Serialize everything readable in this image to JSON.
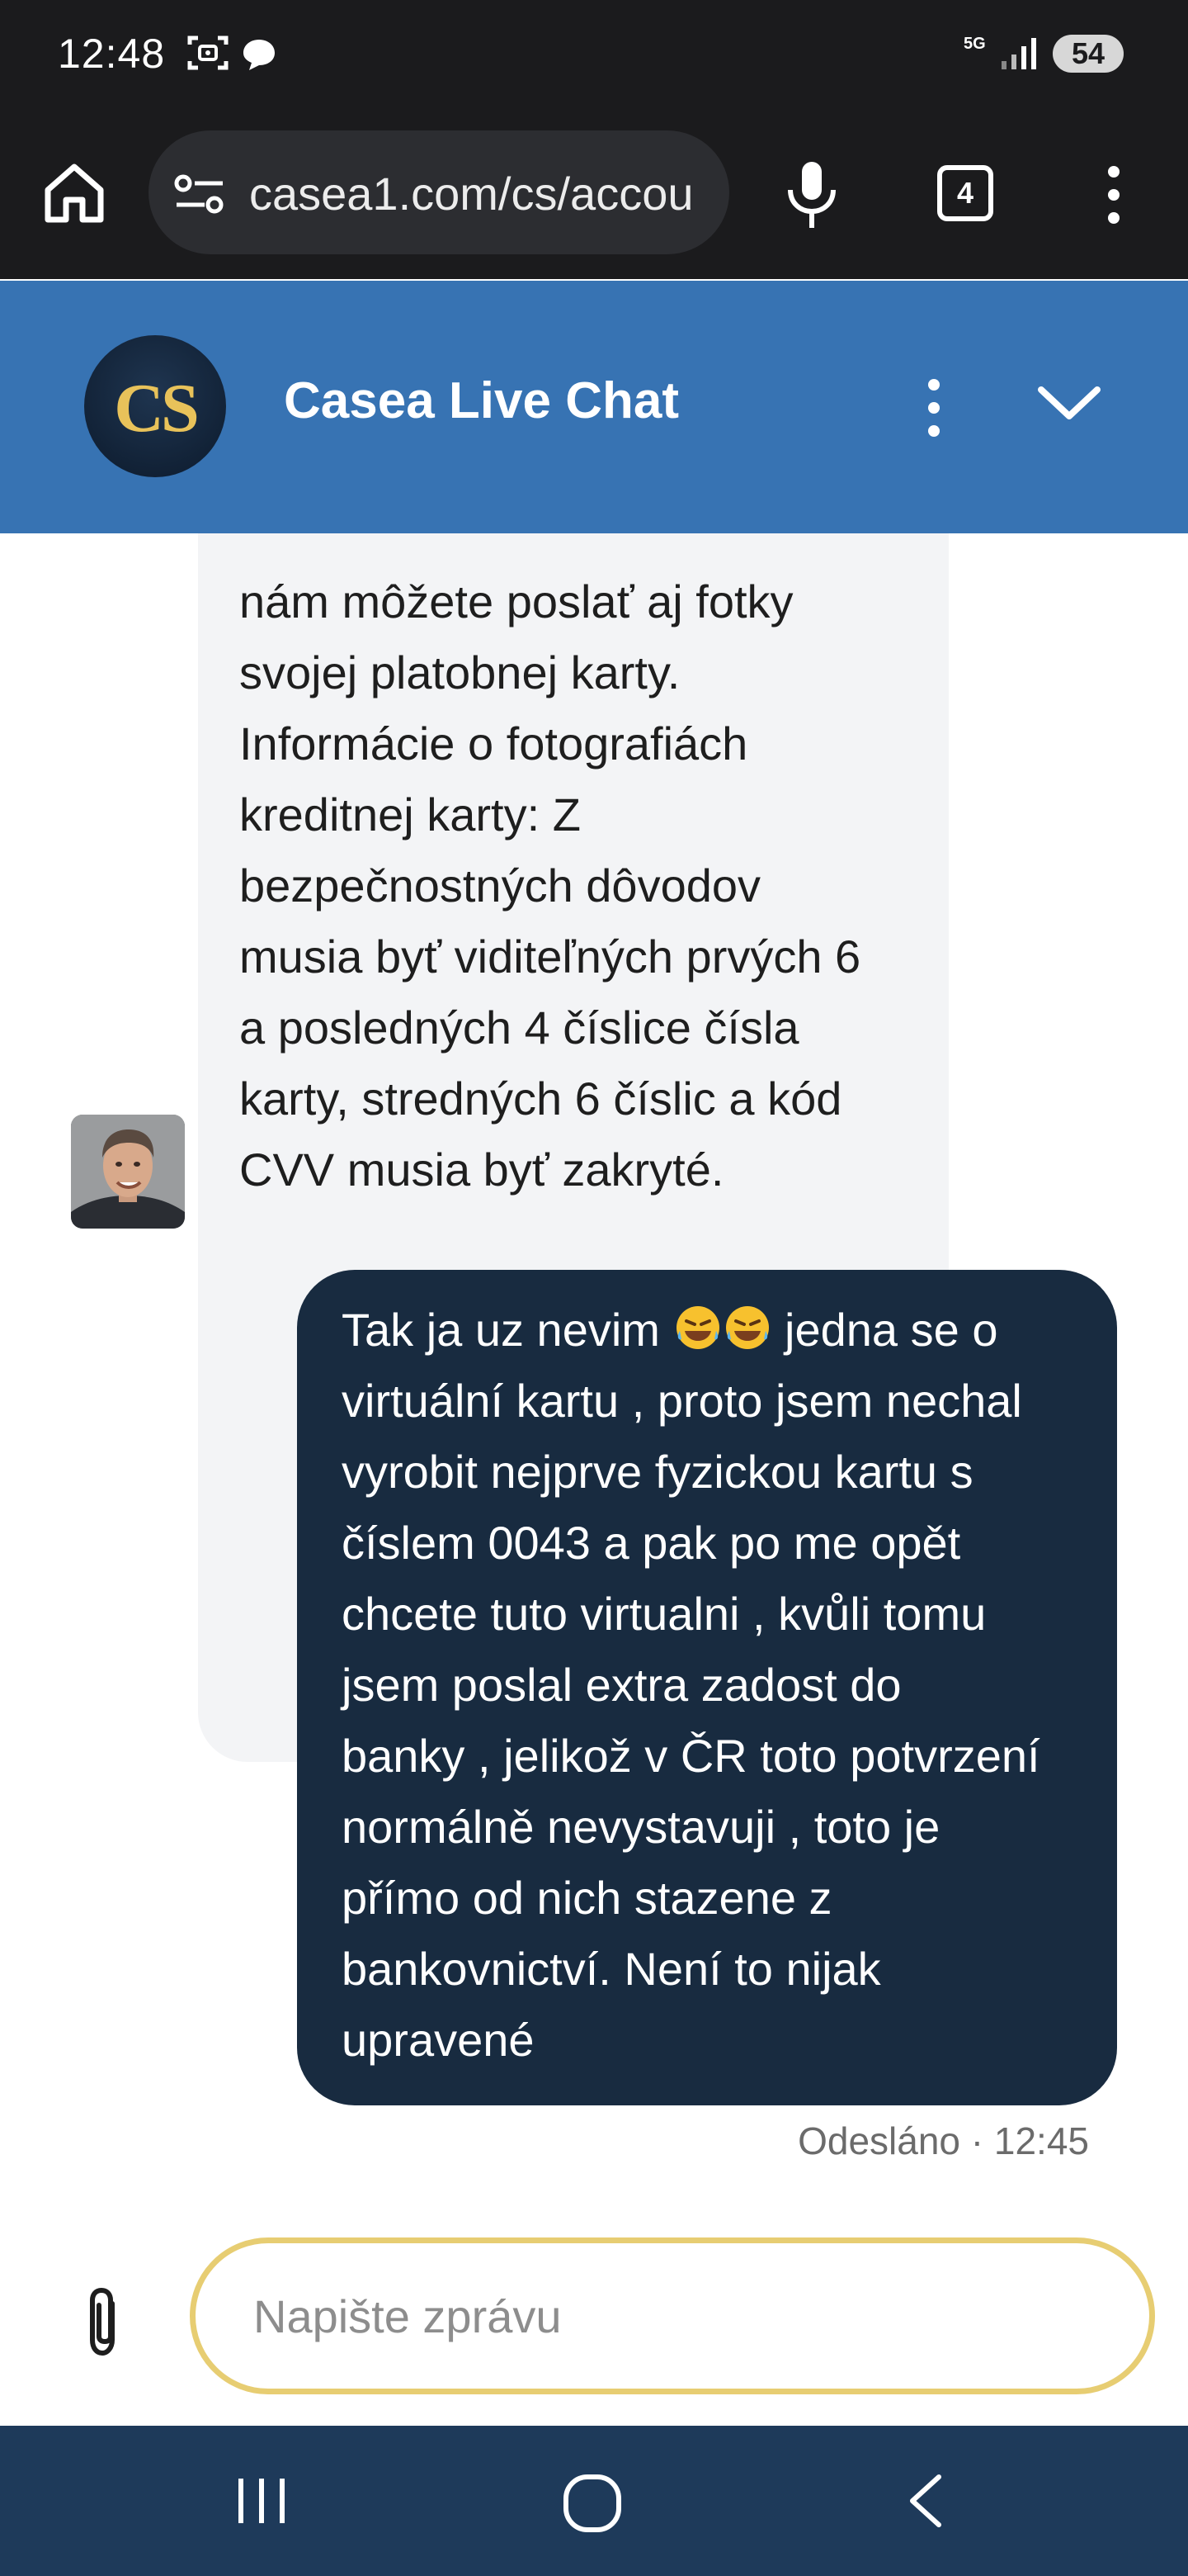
{
  "status_bar": {
    "time": "12:48",
    "network": "5G",
    "battery": "54",
    "icons": [
      "screenshot-icon",
      "chat-notification-icon",
      "signal-icon",
      "battery-icon"
    ]
  },
  "browser": {
    "url": "casea1.com/cs/accou",
    "tab_count": "4",
    "icons": [
      "home-icon",
      "site-settings-icon",
      "mic-icon",
      "tabs-icon",
      "more-vert-icon"
    ]
  },
  "chat_header": {
    "logo_text": "CS",
    "title": "Casea Live Chat",
    "icons": [
      "more-vert-icon",
      "chevron-down-icon"
    ]
  },
  "messages": {
    "incoming": {
      "lines": [
        "nám môžete poslať aj fotky",
        "svojej platobnej karty.",
        "Informácie o fotografiách",
        "kreditnej karty: Z",
        "bezpečnostných dôvodov",
        "musia byť viditeľných prvých 6",
        "a posledných 4 číslice čísla",
        "karty, stredných 6 číslic a kód",
        "CVV musia byť zakryté."
      ]
    },
    "outgoing": {
      "first_line_before": "Tak ja uz nevim ",
      "first_line_after": " jedna se o",
      "emoji": "🤣🤣",
      "lines": [
        "virtuální kartu , proto jsem nechal",
        "vyrobit nejprve fyzickou kartu s",
        "číslem 0043 a pak po me opět",
        "chcete tuto virtualni , kvůli tomu",
        "jsem poslal extra zadost do",
        "banky , jelikož v ČR toto potvrzení",
        "normálně nevystavuji , toto je",
        "přímo od nich stazene z",
        "bankovnictví.  Není to nijak",
        "upravené"
      ],
      "status": "Odesláno · 12:45"
    }
  },
  "composer": {
    "placeholder": "Napište zprávu",
    "value": ""
  },
  "colors": {
    "header_bg": "#3773b3",
    "outgoing_bubble": "#182b40",
    "incoming_bubble": "#f3f4f6",
    "input_border": "#e7cd72",
    "nav_bar": "#1e3a5a"
  }
}
